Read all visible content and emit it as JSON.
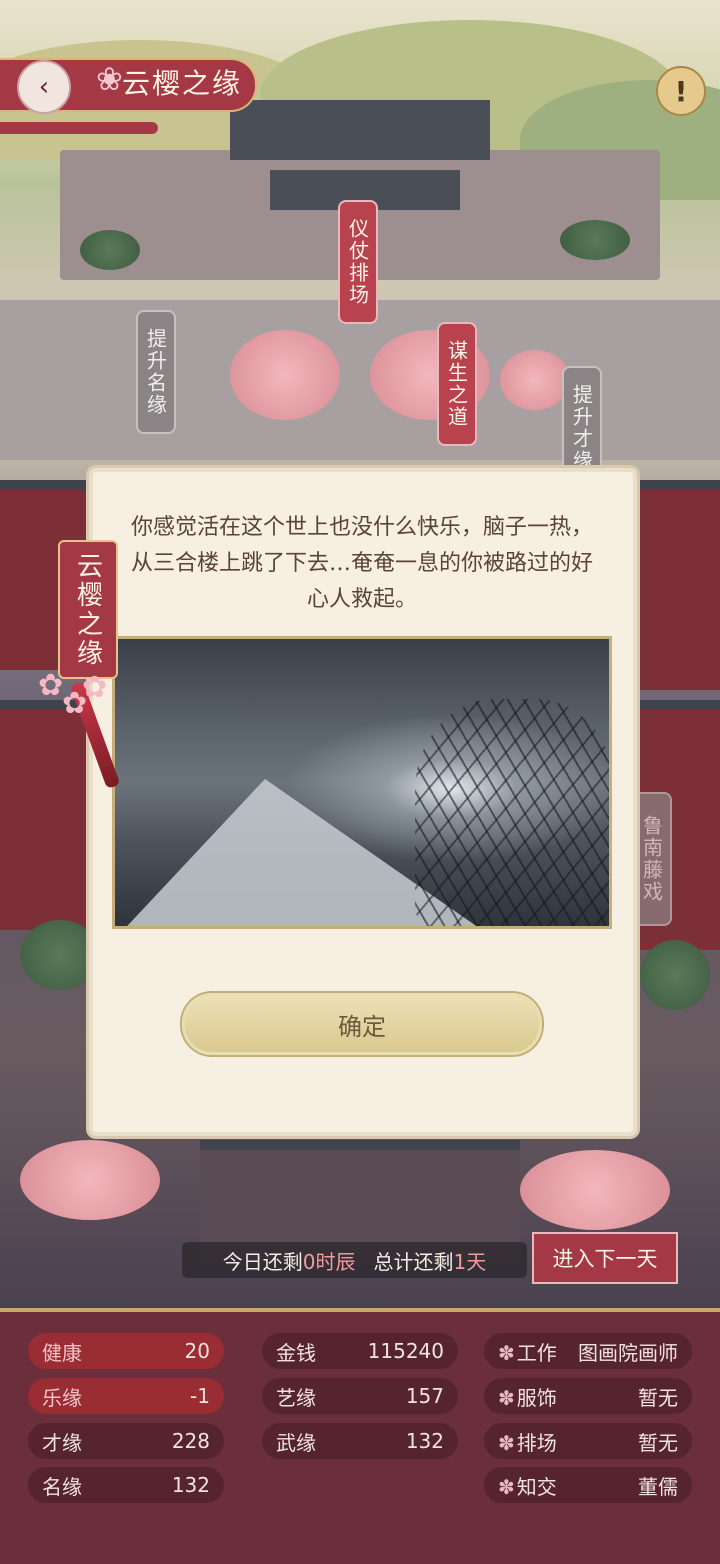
{
  "header": {
    "title": "云樱之缘",
    "back_icon": "chevron-left-icon",
    "alert_label": "!"
  },
  "map_tags": {
    "ceremony": "仪仗排场",
    "livelihood": "谋生之道",
    "fame": "提升名缘",
    "talent": "提升才缘",
    "extra": "鲁南藤戏"
  },
  "dialog": {
    "side_tag": "云樱之缘",
    "message": "你感觉活在这个世上也没什么快乐，脑子一热，从三合楼上跳了下去…奄奄一息的你被路过的好心人救起。",
    "confirm_label": "确定"
  },
  "status": {
    "today_prefix": "今日还剩",
    "today_value": "0时辰",
    "total_prefix": "总计还剩",
    "total_value": "1天",
    "next_day_label": "进入下一天"
  },
  "stats": {
    "health": {
      "label": "健康",
      "value": "20"
    },
    "joy": {
      "label": "乐缘",
      "value": "-1"
    },
    "talent": {
      "label": "才缘",
      "value": "228"
    },
    "fame": {
      "label": "名缘",
      "value": "132"
    },
    "money": {
      "label": "金钱",
      "value": "115240"
    },
    "art": {
      "label": "艺缘",
      "value": "157"
    },
    "martial": {
      "label": "武缘",
      "value": "132"
    },
    "work": {
      "label": "工作",
      "value": "图画院画师"
    },
    "clothing": {
      "label": "服饰",
      "value": "暂无"
    },
    "retinue": {
      "label": "排场",
      "value": "暂无"
    },
    "friend": {
      "label": "知交",
      "value": "董儒"
    }
  },
  "colors": {
    "accent_red": "#a43845",
    "gold": "#d8b57a",
    "panel_bg": "#6b2f3b"
  }
}
